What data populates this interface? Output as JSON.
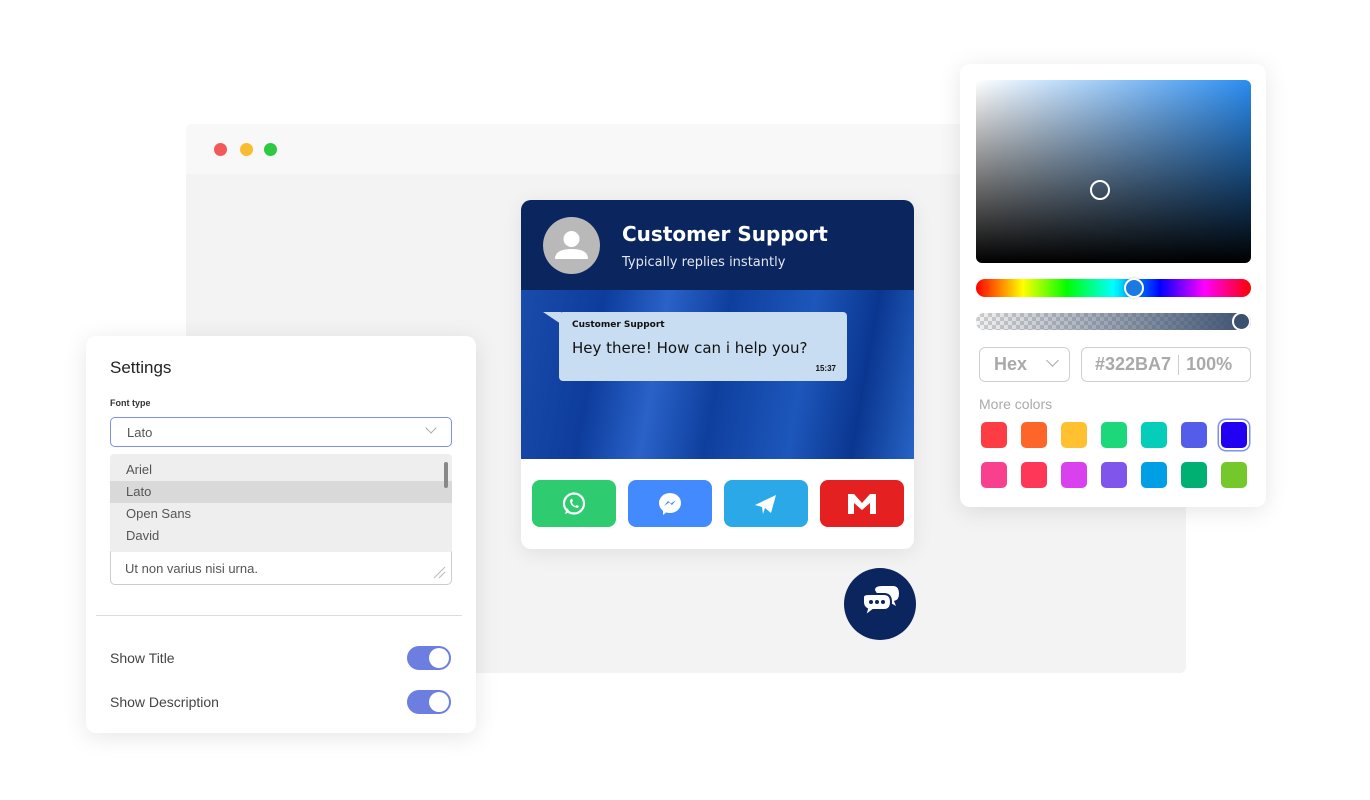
{
  "window": {
    "dots": [
      "#f25a5a",
      "#f7bd2e",
      "#2ec940"
    ]
  },
  "chat": {
    "title": "Customer Support",
    "subtitle": "Typically replies instantly",
    "message": {
      "sender": "Customer Support",
      "text": "Hey there! How can i help you?",
      "time": "15:37"
    },
    "channels": [
      {
        "name": "WhatsApp",
        "icon": "whatsapp-icon",
        "color": "#2ecb70"
      },
      {
        "name": "Messenger",
        "icon": "messenger-icon",
        "color": "#448aff"
      },
      {
        "name": "Telegram",
        "icon": "telegram-icon",
        "color": "#2aa8e8"
      },
      {
        "name": "Gmail",
        "icon": "gmail-icon",
        "color": "#e52020"
      }
    ],
    "launcher_icon": "chat-bubbles-icon",
    "header_color": "#0b255e"
  },
  "color_picker": {
    "format": "Hex",
    "value": "#322BA7",
    "opacity": "100%",
    "more_colors_label": "More colors",
    "swatches": [
      "#fd3c44",
      "#fe6528",
      "#ffc12f",
      "#1cd87b",
      "#04ceba",
      "#535dea",
      "#2200f2",
      "#f8408f",
      "#fe3658",
      "#d940ee",
      "#7f55ec",
      "#009fe5",
      "#00b072",
      "#74c82c"
    ],
    "selected_swatch": "#2200f2"
  },
  "settings": {
    "title": "Settings",
    "font_type_label": "Font type",
    "font_value": "Lato",
    "font_options": [
      "Ariel",
      "Lato",
      "Open Sans",
      "David"
    ],
    "textarea_value": "Ut non varius nisi urna.",
    "show_title_label": "Show Title",
    "show_title": true,
    "show_description_label": "Show Description",
    "show_description": true,
    "toggle_color": "#6c7fe0"
  }
}
